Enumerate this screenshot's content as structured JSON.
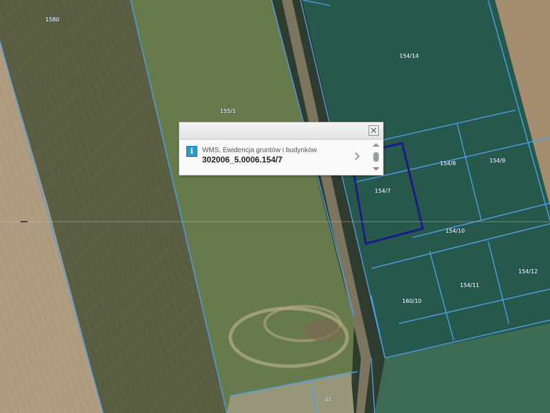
{
  "map": {
    "parcel_labels": [
      "1580",
      "155/1",
      "154/14",
      "154/8",
      "154/9",
      "154/7",
      "154/10",
      "154/11",
      "154/12",
      "160/10",
      "41"
    ],
    "colors": {
      "parcel_boundary": "#4fa0ec",
      "selected_parcel": "#1a1a8c",
      "label_fill": "#ffffff"
    }
  },
  "popup": {
    "layer_name": "WMS, Ewidencja gruntów i budynków",
    "parcel_id": "302006_5.0006.154/7",
    "info_icon": "info-icon",
    "close_icon": "close-icon",
    "next_icon": "chevron-right-icon"
  }
}
